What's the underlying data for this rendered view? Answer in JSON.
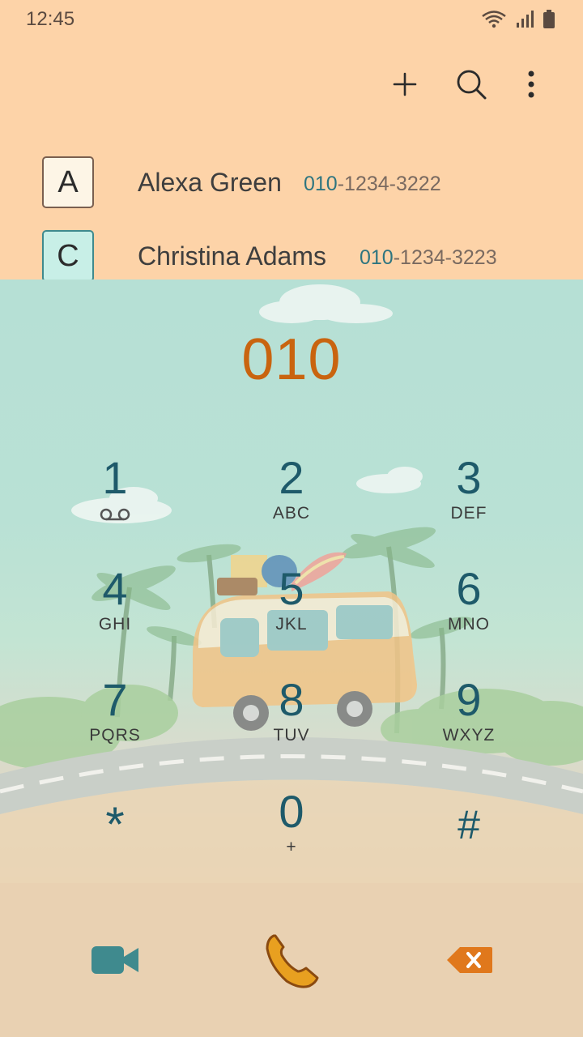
{
  "status_bar": {
    "time": "12:45"
  },
  "contacts": [
    {
      "initial": "A",
      "name": "Alexa Green",
      "number_match": "010",
      "number_rest": "-1234-3222",
      "badge_color": "#fdf5e6"
    },
    {
      "initial": "C",
      "name": "Christina Adams",
      "number_match": "010",
      "number_rest": "-1234-3223",
      "badge_color": "#c8efe7"
    }
  ],
  "dialer": {
    "input": "010",
    "keys": [
      {
        "digit": "1",
        "letters": ""
      },
      {
        "digit": "2",
        "letters": "ABC"
      },
      {
        "digit": "3",
        "letters": "DEF"
      },
      {
        "digit": "4",
        "letters": "GHI"
      },
      {
        "digit": "5",
        "letters": "JKL"
      },
      {
        "digit": "6",
        "letters": "MNO"
      },
      {
        "digit": "7",
        "letters": "PQRS"
      },
      {
        "digit": "8",
        "letters": "TUV"
      },
      {
        "digit": "9",
        "letters": "WXYZ"
      },
      {
        "digit": "*",
        "letters": ""
      },
      {
        "digit": "0",
        "letters": "+"
      },
      {
        "digit": "#",
        "letters": ""
      }
    ]
  },
  "icons": {
    "add": "plus-icon",
    "search": "search-icon",
    "more": "more-vertical-icon",
    "voicemail": "voicemail-icon",
    "video_call": "video-call-icon",
    "call": "phone-icon",
    "backspace": "backspace-icon"
  },
  "colors": {
    "accent": "#c9640f",
    "digit": "#1e5a6a",
    "video": "#3f8a8e",
    "call": "#e8a020",
    "backspace": "#e0781c"
  }
}
